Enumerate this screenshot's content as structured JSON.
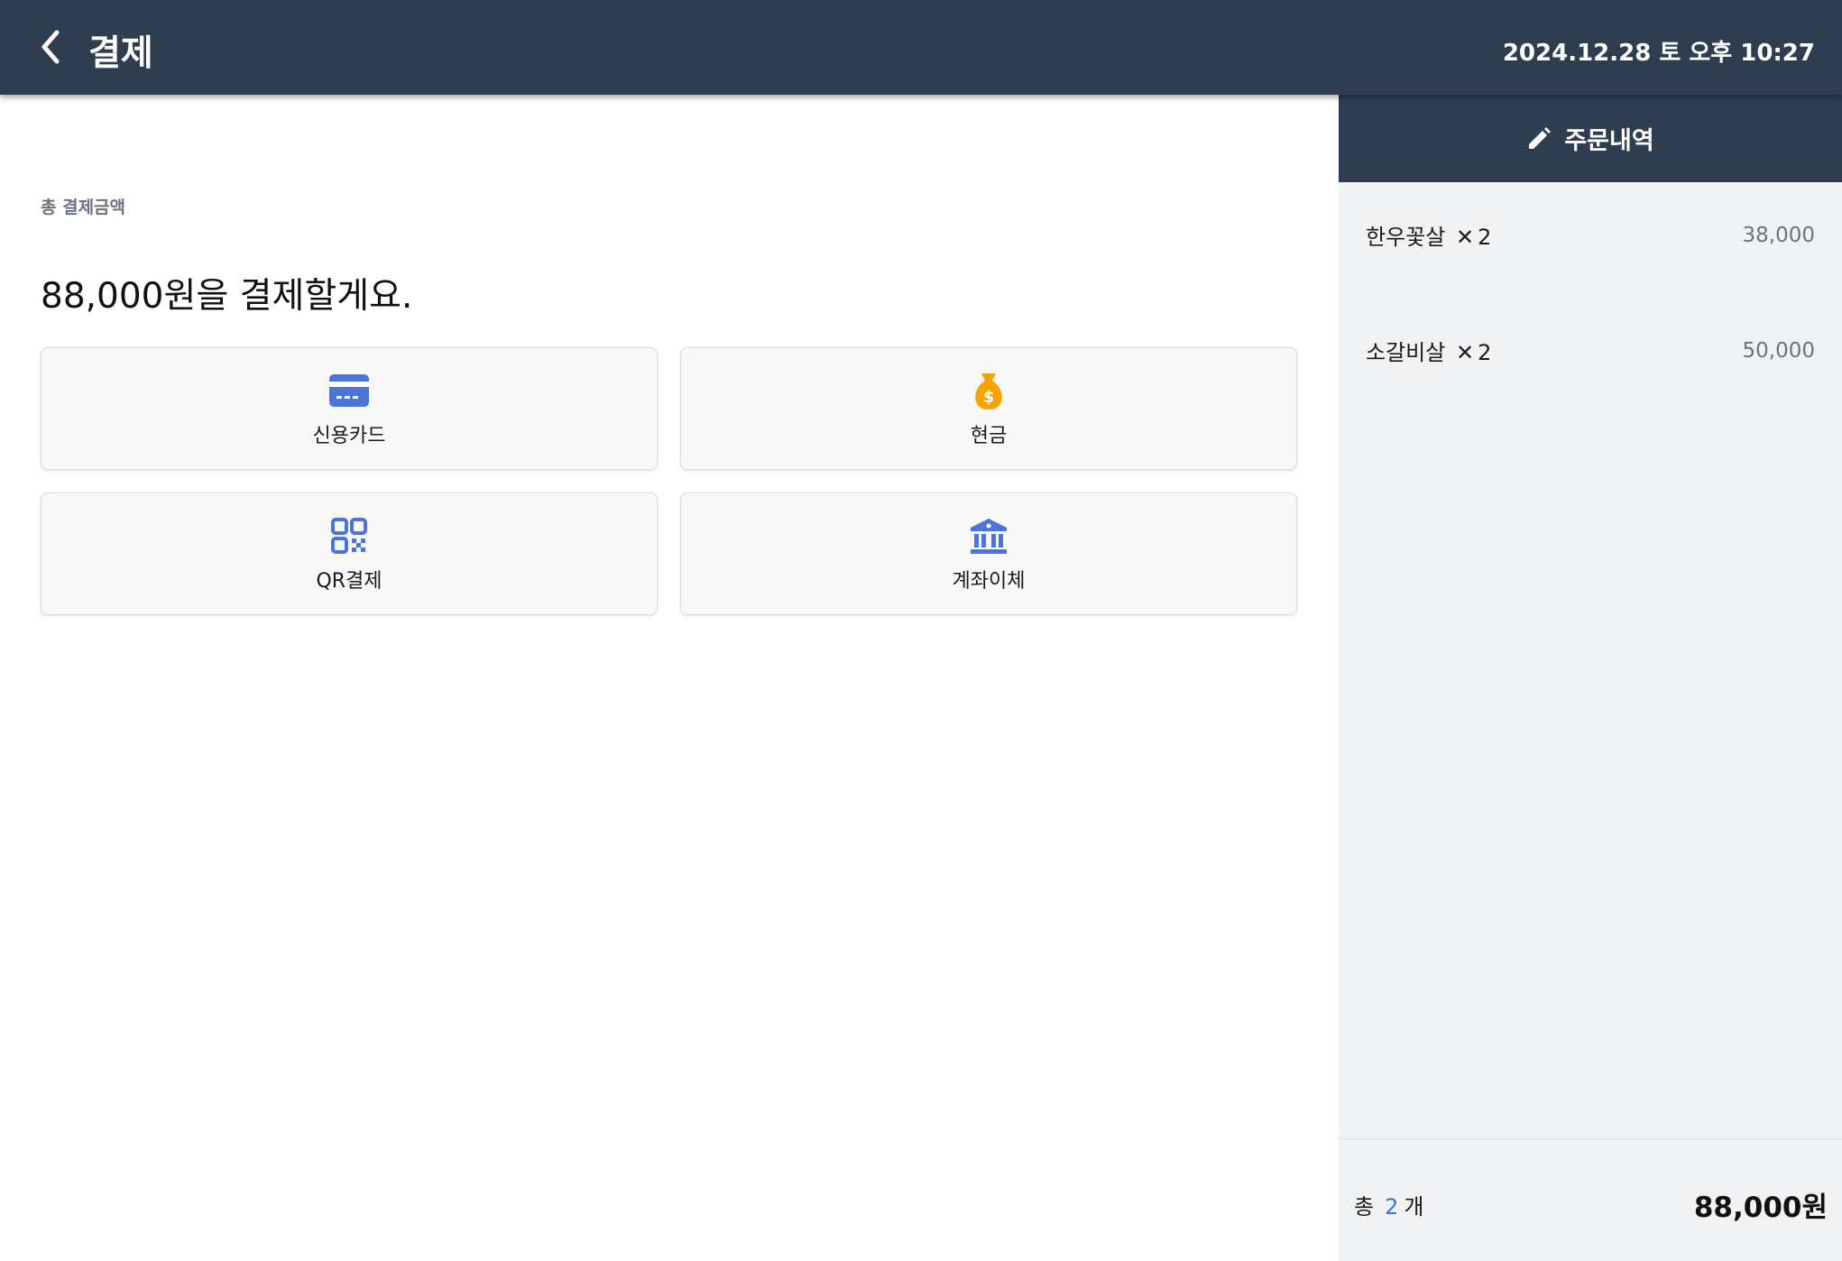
{
  "header": {
    "title": "결제",
    "datetime": "2024.12.28 토 오후 10:27",
    "back_icon": "chevron-left-icon"
  },
  "payment": {
    "total_label": "총 결제금액",
    "headline": "88,000원을 결제할게요.",
    "methods": [
      {
        "label": "신용카드",
        "icon": "credit-card-icon",
        "color": "#4a74d9"
      },
      {
        "label": "현금",
        "icon": "money-bag-icon",
        "color": "#f5a300"
      },
      {
        "label": "QR결제",
        "icon": "qr-code-icon",
        "color": "#4a74d9"
      },
      {
        "label": "계좌이체",
        "icon": "bank-icon",
        "color": "#4a74d9"
      }
    ]
  },
  "order": {
    "header_title": "주문내역",
    "header_icon": "pencil-icon",
    "items": [
      {
        "name": "한우꽃살",
        "times": "✕",
        "qty": "2",
        "price": "38,000"
      },
      {
        "name": "소갈비살",
        "times": "✕",
        "qty": "2",
        "price": "50,000"
      }
    ],
    "footer": {
      "count_prefix": "총",
      "count": "2",
      "count_suffix": "개",
      "total": "88,000원"
    }
  },
  "colors": {
    "header_bg": "#2e3d50",
    "accent": "#4a74d9",
    "cash": "#f5a300"
  }
}
